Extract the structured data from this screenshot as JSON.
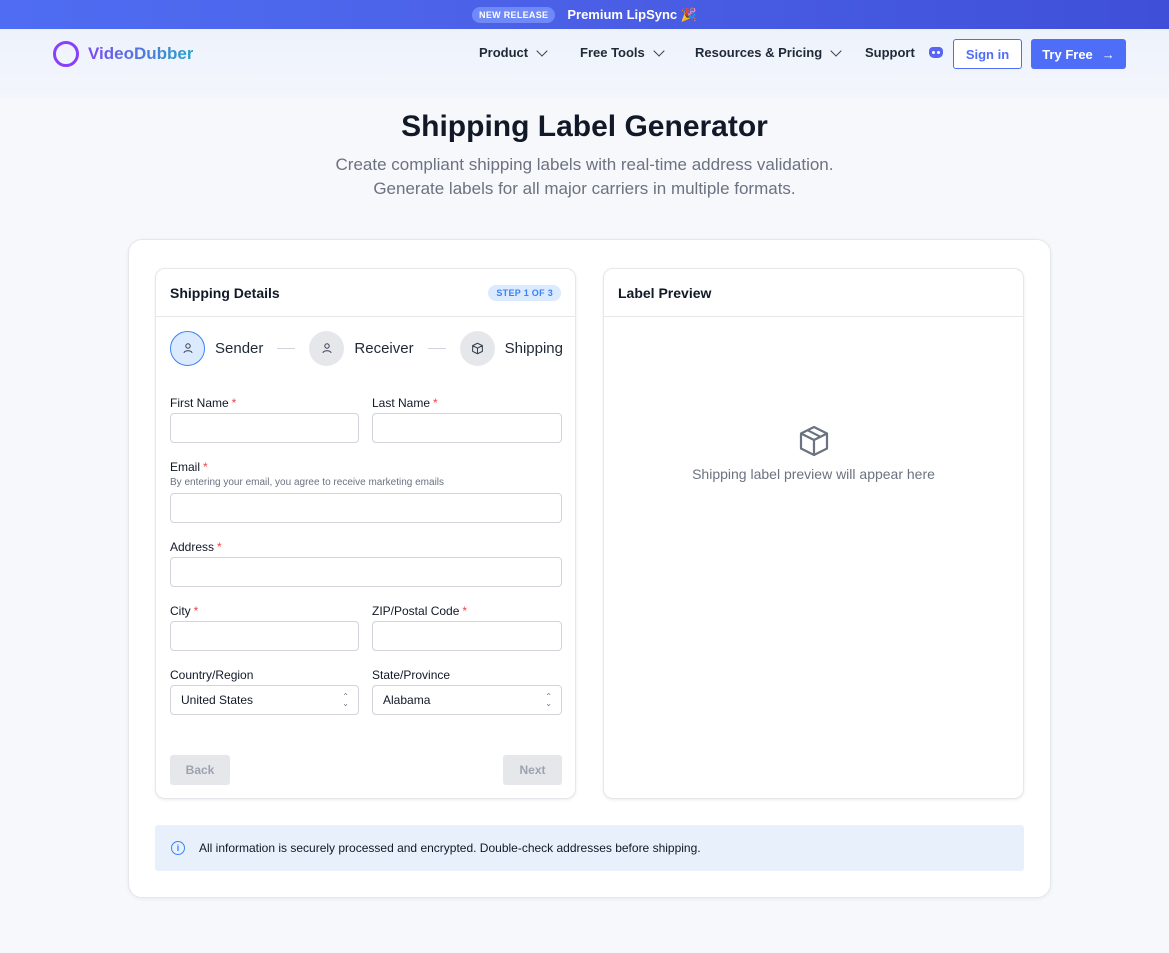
{
  "banner": {
    "badge": "NEW RELEASE",
    "text": "Premium LipSync 🎉"
  },
  "nav": {
    "logo": "VideoDubber",
    "items": [
      {
        "label": "Product"
      },
      {
        "label": "Free Tools"
      },
      {
        "label": "Resources & Pricing"
      },
      {
        "label": "Support"
      }
    ],
    "sign_in": "Sign in",
    "try_free": "Try Free",
    "try_arrow": "→"
  },
  "hero": {
    "title": "Shipping Label Generator",
    "subtitle_line1": "Create compliant shipping labels with real-time address validation.",
    "subtitle_line2": "Generate labels for all major carriers in multiple formats."
  },
  "form": {
    "title": "Shipping Details",
    "step_badge": "STEP 1 OF 3",
    "steps": [
      {
        "label": "Sender"
      },
      {
        "label": "Receiver"
      },
      {
        "label": "Shipping"
      }
    ],
    "fields": {
      "first_name": "First Name",
      "last_name": "Last Name",
      "email": "Email",
      "email_hint": "By entering your email, you agree to receive marketing emails",
      "address": "Address",
      "city": "City",
      "zip": "ZIP/Postal Code",
      "country": "Country/Region",
      "state": "State/Province"
    },
    "required_mark": "*",
    "country_value": "United States",
    "state_value": "Alabama",
    "back": "Back",
    "next": "Next"
  },
  "preview": {
    "title": "Label Preview",
    "empty_text": "Shipping label preview will appear here"
  },
  "notice": {
    "icon_glyph": "i",
    "text": "All information is securely processed and encrypted. Double-check addresses before shipping."
  },
  "colors": {
    "accent": "#4f6ef7",
    "required": "#ef4444",
    "notice_bg": "#e8f1fb"
  }
}
